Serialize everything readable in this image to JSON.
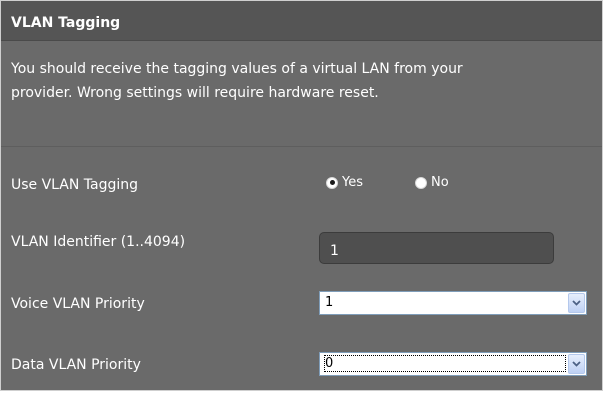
{
  "section": {
    "title": "VLAN Tagging",
    "description": "You should receive the tagging values of a virtual LAN from your provider. Wrong settings will require hardware reset."
  },
  "fields": {
    "use_vlan_tagging": {
      "label": "Use VLAN Tagging",
      "options": [
        {
          "label": "Yes",
          "selected": true
        },
        {
          "label": "No",
          "selected": false
        }
      ]
    },
    "vlan_identifier": {
      "label": "VLAN Identifier (1..4094)",
      "value": "1"
    },
    "voice_vlan_priority": {
      "label": "Voice VLAN Priority",
      "value": "1"
    },
    "data_vlan_priority": {
      "label": "Data VLAN Priority",
      "value": "0"
    }
  },
  "colors": {
    "panel_background": "#6a6a6a",
    "title_background": "#555555",
    "text": "#ffffff",
    "input_background": "#4f4f4f"
  },
  "icons": {
    "dropdown": "chevron-down-icon",
    "radio_selected": "radio-selected-icon",
    "radio_unselected": "radio-unselected-icon"
  }
}
